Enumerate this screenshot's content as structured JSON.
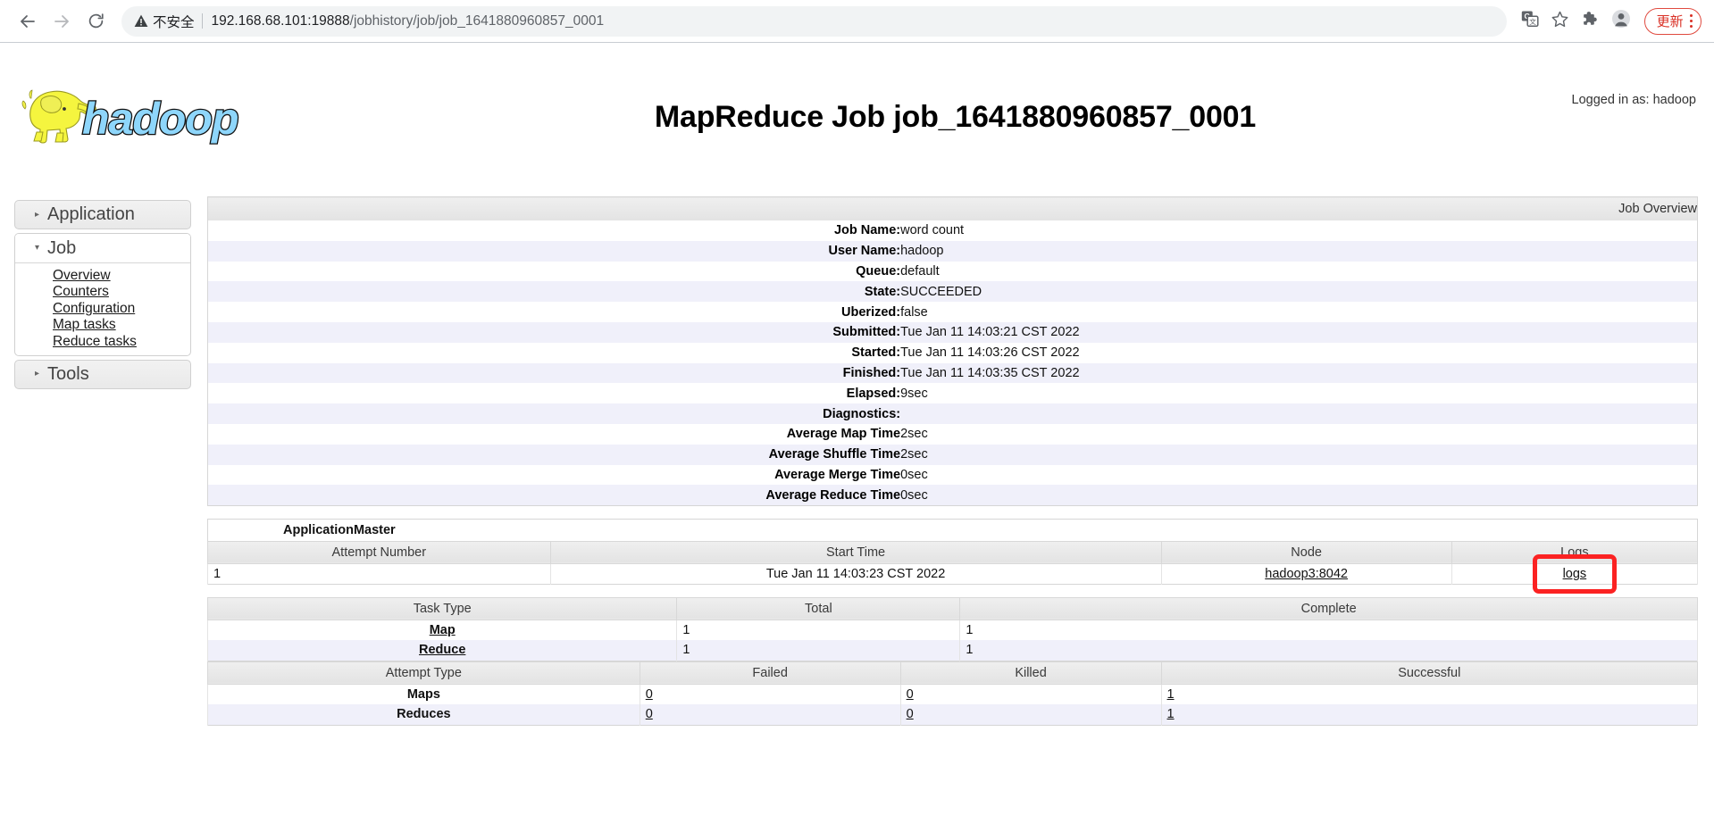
{
  "browser": {
    "back_icon": "back-arrow-icon",
    "forward_icon": "forward-arrow-icon",
    "reload_icon": "reload-icon",
    "security_icon": "warning-triangle-icon",
    "security_label": "不安全",
    "url_host": "192.168.68.101:19888",
    "url_path": "/jobhistory/job/job_1641880960857_0001",
    "url_full": "192.168.68.101:19888/jobhistory/job/job_1641880960857_0001",
    "actions": {
      "translate_icon": "translate-icon",
      "bookmark_icon": "star-icon",
      "extensions_icon": "puzzle-piece-icon",
      "profile_icon": "profile-avatar-icon",
      "update_label": "更新",
      "menu_icon": "three-dot-menu-icon"
    }
  },
  "header": {
    "logo_alt": "hadoop",
    "logged_in": "Logged in as: hadoop",
    "title": "MapReduce Job job_1641880960857_0001"
  },
  "sidebar": {
    "sections": [
      {
        "label": "Application",
        "expanded": false,
        "marker": "▸",
        "links": []
      },
      {
        "label": "Job",
        "expanded": true,
        "marker": "▾",
        "links": [
          "Overview",
          "Counters",
          "Configuration",
          "Map tasks",
          "Reduce tasks"
        ]
      },
      {
        "label": "Tools",
        "expanded": false,
        "marker": "▸",
        "links": []
      }
    ]
  },
  "job_overview": {
    "caption": "Job Overview",
    "rows": [
      {
        "label": "Job Name:",
        "value": "word count"
      },
      {
        "label": "User Name:",
        "value": "hadoop"
      },
      {
        "label": "Queue:",
        "value": "default"
      },
      {
        "label": "State:",
        "value": "SUCCEEDED"
      },
      {
        "label": "Uberized:",
        "value": "false"
      },
      {
        "label": "Submitted:",
        "value": "Tue Jan 11 14:03:21 CST 2022"
      },
      {
        "label": "Started:",
        "value": "Tue Jan 11 14:03:26 CST 2022"
      },
      {
        "label": "Finished:",
        "value": "Tue Jan 11 14:03:35 CST 2022"
      },
      {
        "label": "Elapsed:",
        "value": "9sec"
      },
      {
        "label": "Diagnostics:",
        "value": ""
      },
      {
        "label": "Average Map Time",
        "value": "2sec"
      },
      {
        "label": "Average Shuffle Time",
        "value": "2sec"
      },
      {
        "label": "Average Merge Time",
        "value": "0sec"
      },
      {
        "label": "Average Reduce Time",
        "value": "0sec"
      }
    ]
  },
  "application_master": {
    "title": "ApplicationMaster",
    "headers": [
      "Attempt Number",
      "Start Time",
      "Node",
      "Logs"
    ],
    "rows": [
      {
        "attempt_number": "1",
        "start_time": "Tue Jan 11 14:03:23 CST 2022",
        "node": "hadoop3:8042",
        "logs": "logs"
      }
    ],
    "highlight_color": "#fb2222"
  },
  "task_summary": {
    "headers": [
      "Task Type",
      "Total",
      "Complete"
    ],
    "rows": [
      {
        "type": "Map",
        "total": "1",
        "complete": "1"
      },
      {
        "type": "Reduce",
        "total": "1",
        "complete": "1"
      }
    ]
  },
  "attempt_summary": {
    "headers": [
      "Attempt Type",
      "Failed",
      "Killed",
      "Successful"
    ],
    "rows": [
      {
        "type": "Maps",
        "failed": "0",
        "killed": "0",
        "successful": "1"
      },
      {
        "type": "Reduces",
        "failed": "0",
        "killed": "0",
        "successful": "1"
      }
    ]
  }
}
